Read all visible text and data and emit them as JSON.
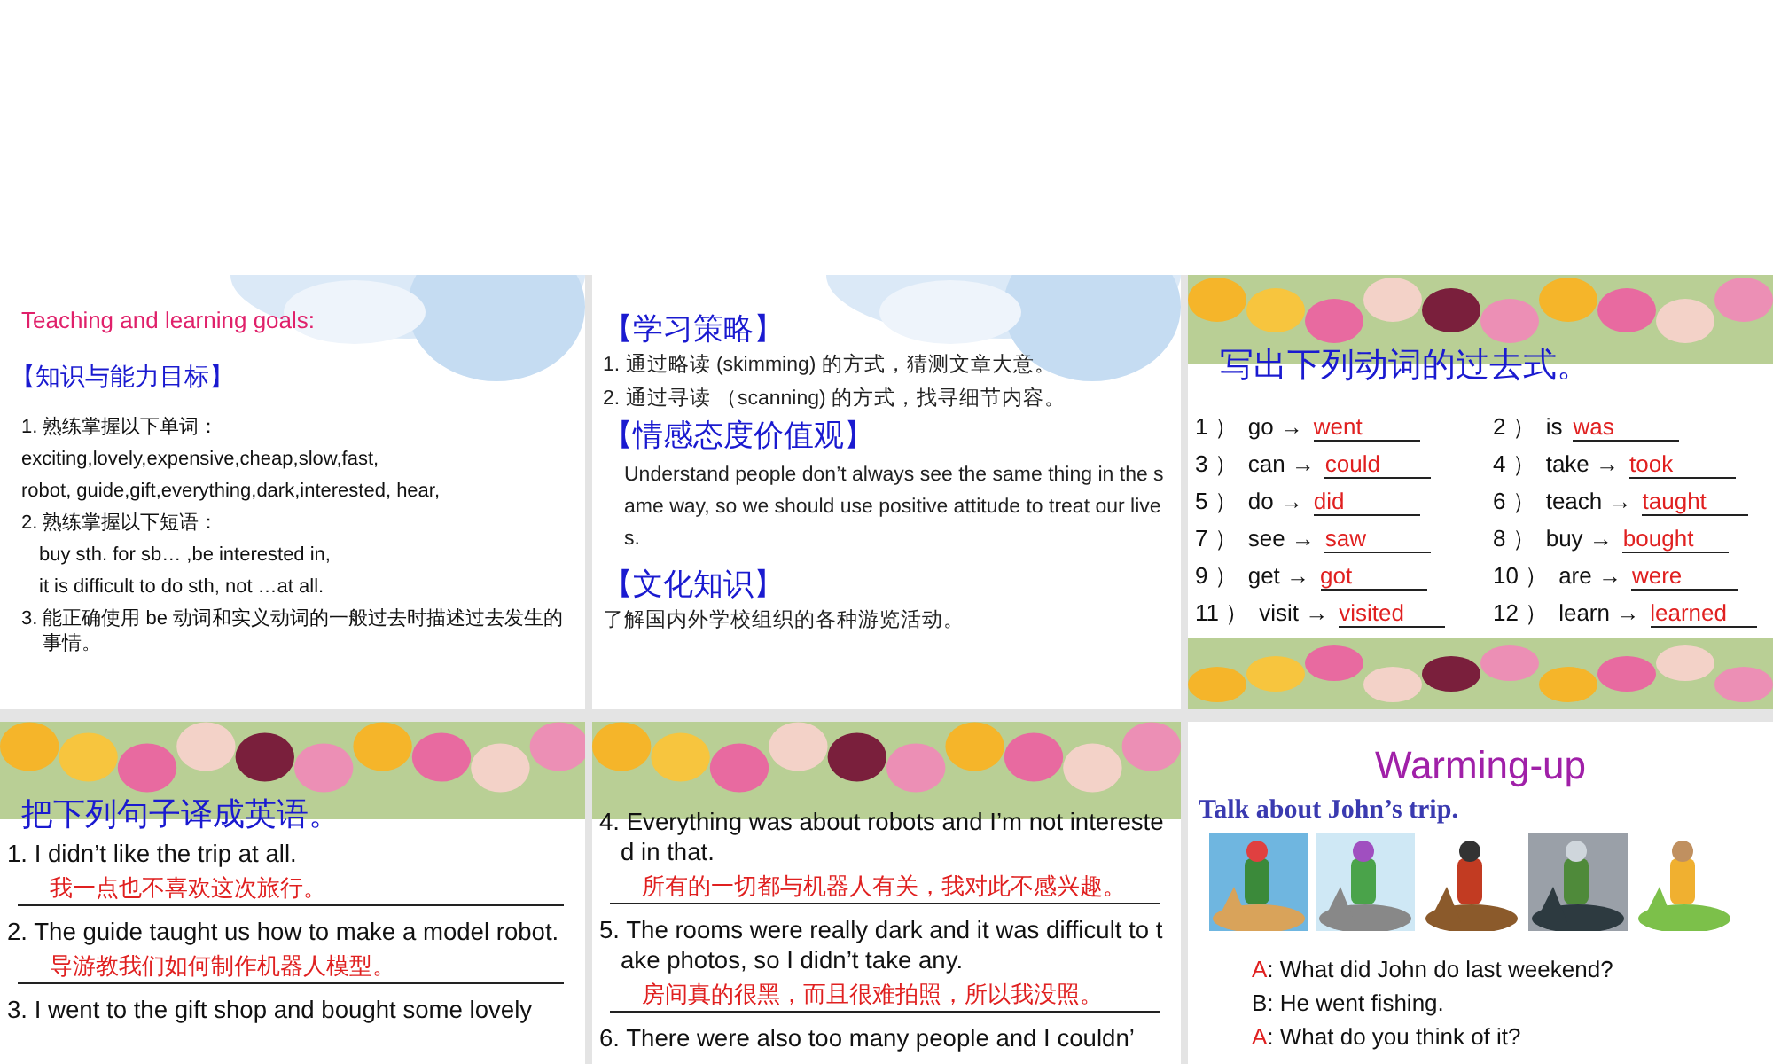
{
  "slides": [
    {
      "kind": "goals",
      "title": "Teaching and learning goals:",
      "heading": "【知识与能力目标】",
      "lines": [
        {
          "text": "1. 熟练掌握以下单词：",
          "indent": false
        },
        {
          "text": "exciting,lovely,expensive,cheap,slow,fast,",
          "indent": false
        },
        {
          "text": "robot, guide,gift,everything,dark,interested, hear,",
          "indent": false
        },
        {
          "text": "2. 熟练掌握以下短语：",
          "indent": false
        },
        {
          "text": "buy sth. for sb… ,be interested in,",
          "indent": true
        },
        {
          "text": "it is difficult to do sth, not …at all.",
          "indent": true
        },
        {
          "text": "3. 能正确使用 be 动词和实义动词的一般过去时描述过去发生的事情。",
          "indent": false
        }
      ]
    },
    {
      "kind": "strategy",
      "sections": [
        {
          "heading": "【学习策略】",
          "lines": [
            "1. 通过略读 (skimming) 的方式，猜测文章大意。",
            "2. 通过寻读 （scanning) 的方式，找寻细节内容。"
          ],
          "indent": false
        },
        {
          "heading": "【情感态度价值观】",
          "lines": [
            "Understand people don’t always see the same thing in the same way, so we should use positive attitude to treat our lives."
          ],
          "indent": true
        },
        {
          "heading": "【文化知识】",
          "lines": [
            "了解国内外学校组织的各种游览活动。"
          ],
          "indent": false
        }
      ]
    },
    {
      "kind": "verbs",
      "title": "写出下列动词的过去式。",
      "items": [
        {
          "num": "1 ）",
          "verb": "go →",
          "answer": "went"
        },
        {
          "num": "2 ）",
          "verb": "is",
          "answer": "was"
        },
        {
          "num": "3 ）",
          "verb": "can →",
          "answer": "could"
        },
        {
          "num": "4 ）",
          "verb": "take →",
          "answer": "took"
        },
        {
          "num": "5 ）",
          "verb": "do →",
          "answer": "did"
        },
        {
          "num": "6 ）",
          "verb": "teach →",
          "answer": "taught"
        },
        {
          "num": "7 ）",
          "verb": "see →",
          "answer": "saw"
        },
        {
          "num": "8 ）",
          "verb": "buy →",
          "answer": "bought"
        },
        {
          "num": "9 ）",
          "verb": "get →",
          "answer": "got"
        },
        {
          "num": "10 ）",
          "verb": "are →",
          "answer": "were"
        },
        {
          "num": "11 ）",
          "verb": "visit →",
          "answer": "visited"
        },
        {
          "num": "12 ）",
          "verb": "learn →",
          "answer": "learned"
        }
      ]
    },
    {
      "kind": "translate",
      "title": "把下列句子译成英语。",
      "items": [
        {
          "en": "1. I didn’t like the trip at all.",
          "zh": "我一点也不喜欢这次旅行。"
        },
        {
          "en": "2. The guide taught us how to make a model robot.",
          "zh": "导游教我们如何制作机器人模型。"
        },
        {
          "en": "3. I went to the gift shop and bought some lovely"
        }
      ]
    },
    {
      "kind": "translate",
      "items": [
        {
          "en": "4. Everything was about robots and I’m not interested in that.",
          "zh": "所有的一切都与机器人有关，我对此不感兴趣。"
        },
        {
          "en": "5. The rooms were really dark and it was difficult to take photos, so I didn’t take any.",
          "zh": "房间真的很黑，而且很难拍照，所以我没照。"
        },
        {
          "en": "6. There were also too many people and I couldn’"
        }
      ]
    },
    {
      "kind": "warmup",
      "title": "Warming-up",
      "subtitle": "Talk about John’s trip.",
      "dialogue": [
        {
          "speaker": "A",
          "text": ": What did John do last weekend?",
          "color": "#e02020"
        },
        {
          "speaker": "B",
          "text": ": He went fishing.",
          "color": "#111111"
        },
        {
          "speaker": "A",
          "text": ": What do you think of it?",
          "color": "#e02020"
        }
      ]
    }
  ]
}
